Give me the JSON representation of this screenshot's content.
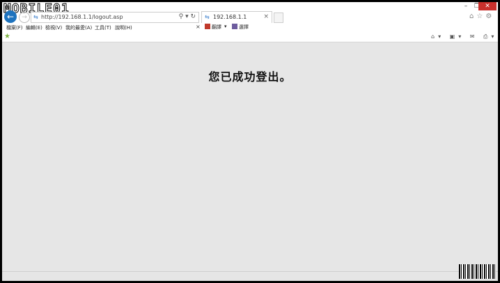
{
  "watermark": "MOBILE01",
  "address": {
    "url": "http://192.168.1.1/logout.asp",
    "search_glyph": "⚲ ▾ ↻"
  },
  "tab": {
    "title": "192.168.1.1",
    "close": "×"
  },
  "window_controls": {
    "min": "–",
    "max": "❐",
    "close": "✕"
  },
  "menu": {
    "items": [
      "檔案(F)",
      "編輯(E)",
      "檢視(V)",
      "我的最愛(A)",
      "工具(T)",
      "說明(H)"
    ],
    "close": "×"
  },
  "toolbar": {
    "translate_label": "翻譯",
    "select_label": "選擇",
    "dropdown": "▾"
  },
  "command_icons": "⌂▾ ▣▾ ✉ ⎙▾",
  "nav_icons": "⌂☆⚙",
  "content": {
    "message": "您已成功登出。"
  }
}
